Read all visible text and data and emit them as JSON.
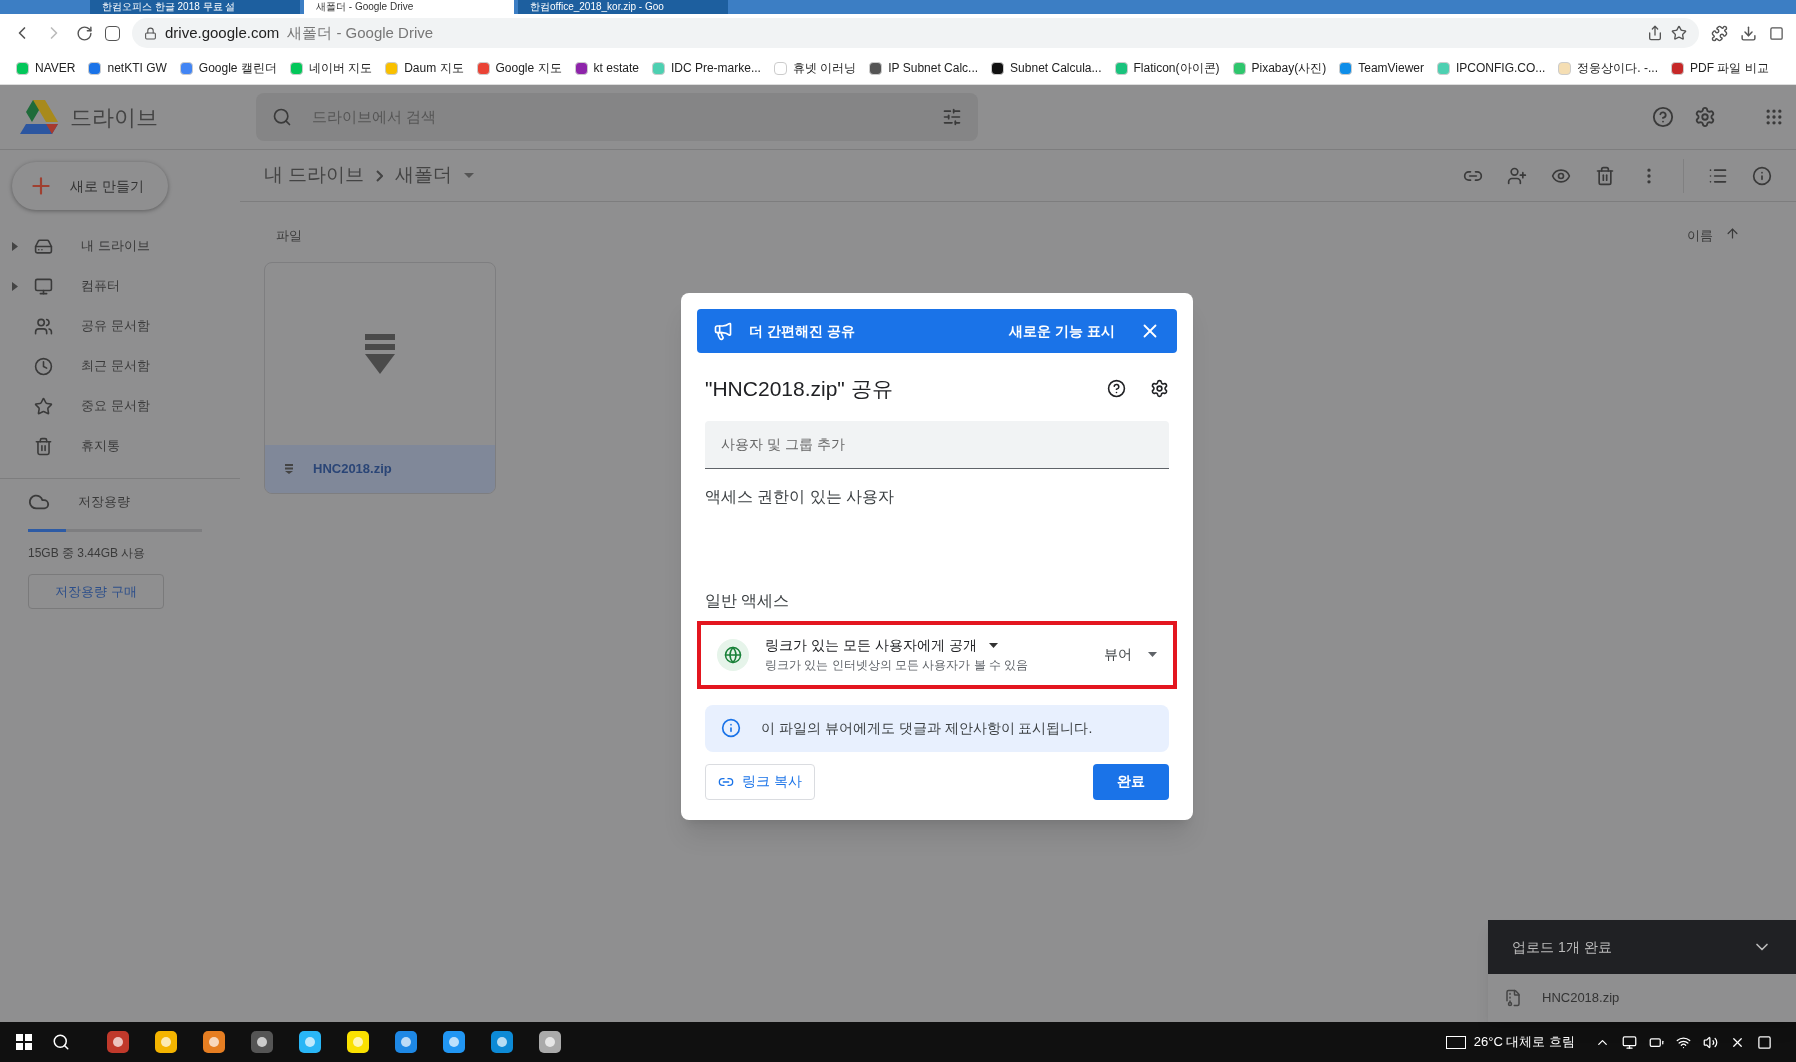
{
  "browser": {
    "tabs": [
      {
        "title": "한컴오피스 한글 2018 무료 설",
        "selected": false
      },
      {
        "title": "새폴더 - Google Drive",
        "selected": true
      },
      {
        "title": "한컴office_2018_kor.zip - Goo",
        "selected": false
      }
    ],
    "url_host": "drive.google.com",
    "url_rest": "새폴더 - Google Drive",
    "bookmarks": [
      {
        "label": "NAVER",
        "color": "#03c75a"
      },
      {
        "label": "netKTI GW",
        "color": "#1a73e8"
      },
      {
        "label": "Google 캘린더",
        "color": "#4285f4"
      },
      {
        "label": "네이버 지도",
        "color": "#03c75a"
      },
      {
        "label": "Daum 지도",
        "color": "#f9c000"
      },
      {
        "label": "Google 지도",
        "color": "#ea4335"
      },
      {
        "label": "kt estate",
        "color": "#8e24aa"
      },
      {
        "label": "IDC Pre-marke...",
        "color": "#4dd0b1"
      },
      {
        "label": "휴넷 이러닝",
        "color": "#ffffff"
      },
      {
        "label": "IP Subnet Calc...",
        "color": "#555555"
      },
      {
        "label": "Subnet Calcula...",
        "color": "#111111"
      },
      {
        "label": "Flaticon(아이콘)",
        "color": "#19c37d"
      },
      {
        "label": "Pixabay(사진)",
        "color": "#2ec66d"
      },
      {
        "label": "TeamViewer",
        "color": "#0e8ee9"
      },
      {
        "label": "IPCONFIG.CO...",
        "color": "#4dd0b1"
      },
      {
        "label": "정웅상이다. -...",
        "color": "#f5deb3"
      },
      {
        "label": "PDF 파일 비교",
        "color": "#c62828"
      }
    ]
  },
  "drive": {
    "logo_text": "드라이브",
    "search": {
      "placeholder": "드라이브에서 검색"
    },
    "new_button": "새로 만들기",
    "nav": [
      {
        "label": "내 드라이브",
        "expandable": true
      },
      {
        "label": "컴퓨터",
        "expandable": true
      },
      {
        "label": "공유 문서함",
        "expandable": false
      },
      {
        "label": "최근 문서함",
        "expandable": false
      },
      {
        "label": "중요 문서함",
        "expandable": false
      },
      {
        "label": "휴지통",
        "expandable": false
      }
    ],
    "storage": {
      "label": "저장용량",
      "level": 0.22,
      "usage": "15GB 중 3.44GB 사용",
      "buy_button": "저장용량 구매"
    },
    "breadcrumb": [
      "내 드라이브",
      "새폴더"
    ],
    "section_label": "파일",
    "sort_label": "이름",
    "files": [
      {
        "name": "HNC2018.zip",
        "selected": true
      }
    ]
  },
  "dialog": {
    "banner": {
      "text": "더 간편해진 공유",
      "link": "새로운 기능 표시"
    },
    "title": "\"HNC2018.zip\" 공유",
    "add_people": {
      "placeholder": "사용자 및 그룹 추가"
    },
    "people_heading": "액세스 권한이 있는 사용자",
    "general_heading": "일반 액세스",
    "access": {
      "title": "링크가 있는 모든 사용자에게 공개",
      "description": "링크가 있는 인터넷상의 모든 사용자가 볼 수 있음",
      "role": "뷰어",
      "highlighted": true
    },
    "info": "이 파일의 뷰어에게도 댓글과 제안사항이 표시됩니다.",
    "copy_link": "링크 복사",
    "done": "완료"
  },
  "upload_panel": {
    "title": "업로드 1개 완료",
    "files": [
      "HNC2018.zip"
    ]
  },
  "taskbar": {
    "weather": "26°C 대체로 흐림"
  }
}
